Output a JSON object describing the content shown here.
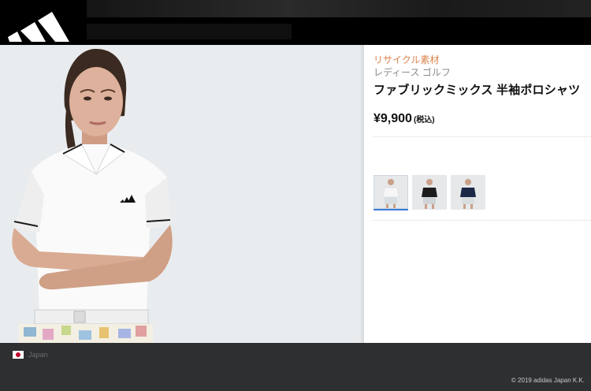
{
  "header": {
    "logo_icon": "adidas-performance-logo-icon"
  },
  "product": {
    "badge": "リサイクル素材",
    "category": "レディース ゴルフ",
    "name": "ファブリックミックス 半袖ポロシャツ",
    "price": "¥9,900",
    "tax_note": "(税込)",
    "badge_color": "#d9834b"
  },
  "colorways": {
    "selected_index": 0,
    "items": [
      {
        "icon": "white-polo-thumbnail-icon",
        "shirt_color": "#f4f4f4",
        "skirt_color": "#d7dde0"
      },
      {
        "icon": "black-polo-thumbnail-icon",
        "shirt_color": "#1c1c1c",
        "skirt_color": "#cfd3d6"
      },
      {
        "icon": "navy-polo-thumbnail-icon",
        "shirt_color": "#1d2846",
        "skirt_color": "#d8dde0"
      }
    ]
  },
  "footer": {
    "flag_icon": "japan-flag-icon",
    "country": "Japan",
    "copyright": "© 2019 adidas Japan K.K."
  }
}
